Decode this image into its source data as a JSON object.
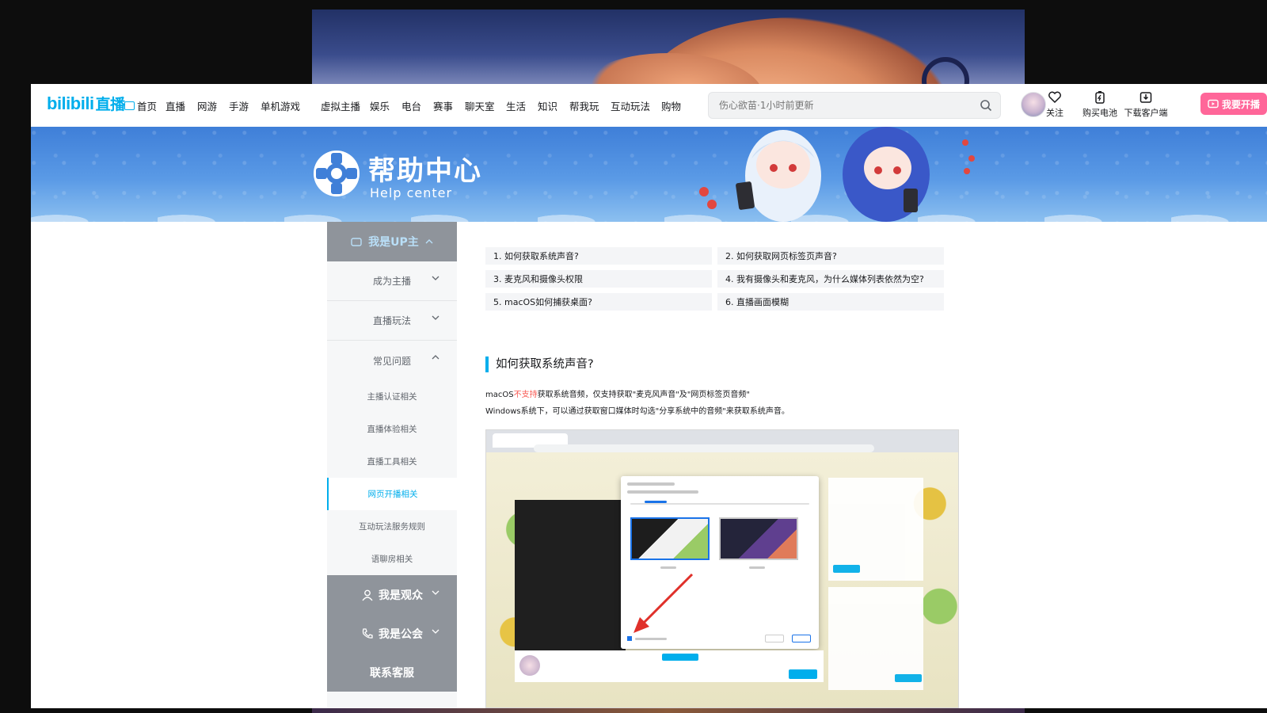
{
  "header": {
    "logo_text": "bilibili",
    "logo_zh": "直播",
    "nav": [
      "首页",
      "直播",
      "网游",
      "手游",
      "单机游戏",
      "虚拟主播",
      "娱乐",
      "电台",
      "赛事",
      "聊天室",
      "生活",
      "知识",
      "帮我玩",
      "互动玩法",
      "购物"
    ],
    "search_placeholder": "伤心欲苗·1小时前更新",
    "actions": {
      "follow": "关注",
      "battery": "购买电池",
      "download": "下载客户端"
    },
    "live_button": "我要开播"
  },
  "banner": {
    "title": "帮助中心",
    "subtitle": "Help center"
  },
  "sidebar": {
    "top_section": "我是UP主",
    "items": [
      "成为主播",
      "直播玩法",
      "常见问题"
    ],
    "sub_items": [
      "主播认证相关",
      "直播体验相关",
      "直播工具相关",
      "网页开播相关",
      "互动玩法服务规则",
      "语聊房相关"
    ],
    "active_sub": "网页开播相关",
    "bottom_sections": [
      "我是观众",
      "我是公会",
      "联系客服"
    ]
  },
  "faq": [
    "1. 如何获取系统声音?",
    "2. 如何获取网页标签页声音?",
    "3. 麦克风和摄像头权限",
    "4. 我有摄像头和麦克风，为什么媒体列表依然为空?",
    "5. macOS如何捕获桌面?",
    "6. 直播画面模糊"
  ],
  "section": {
    "title": "如何获取系统声音?",
    "p1_prefix": "macOS",
    "p1_red": "不支持",
    "p1_suffix": "获取系统音频，仅支持获取\"麦克风声音\"及\"网页标签页音频\"",
    "p2": "Windows系统下，可以通过获取窗口媒体时勾选\"分享系统中的音频\"来获取系统声音。"
  },
  "colors": {
    "brand_blue": "#00aeec",
    "brand_pink": "#ff6699",
    "sidebar_dark": "#8f949b",
    "highlight_red": "#f85a54"
  },
  "icons": [
    "tv-icon",
    "search-icon",
    "heart-icon",
    "battery-icon",
    "download-icon",
    "camera-icon",
    "chevron-down-icon",
    "chevron-up-icon",
    "user-icon",
    "phone-icon",
    "lifebuoy-icon"
  ]
}
